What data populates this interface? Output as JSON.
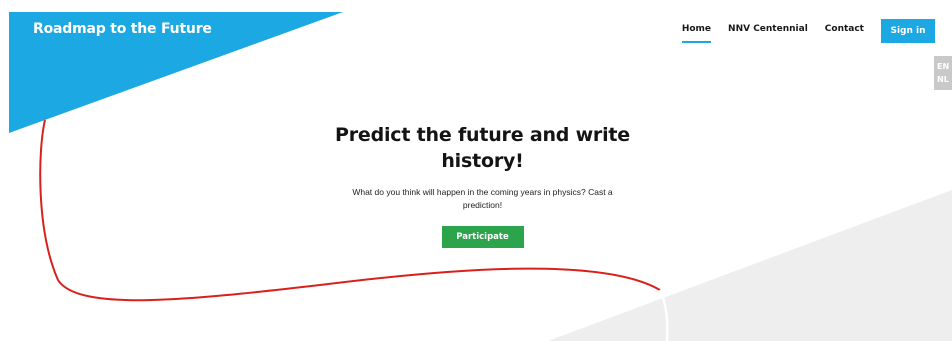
{
  "header": {
    "brand": "Roadmap to the Future"
  },
  "nav": {
    "items": [
      {
        "label": "Home",
        "active": true
      },
      {
        "label": "NNV Centennial",
        "active": false
      },
      {
        "label": "Contact",
        "active": false
      }
    ],
    "signin_label": "Sign in"
  },
  "language": {
    "options": [
      "EN",
      "NL"
    ]
  },
  "hero": {
    "title_line1": "Predict the future and write",
    "title_line2": "history!",
    "subtitle": "What do you think will happen in the coming years in physics? Cast a prediction!",
    "cta_label": "Participate"
  },
  "colors": {
    "brand_blue": "#1ca8e3",
    "cta_green": "#2ca44b",
    "curve_red": "#d9201a",
    "grey_shape": "#eeeeef",
    "lang_grey": "#c9c9c9"
  }
}
